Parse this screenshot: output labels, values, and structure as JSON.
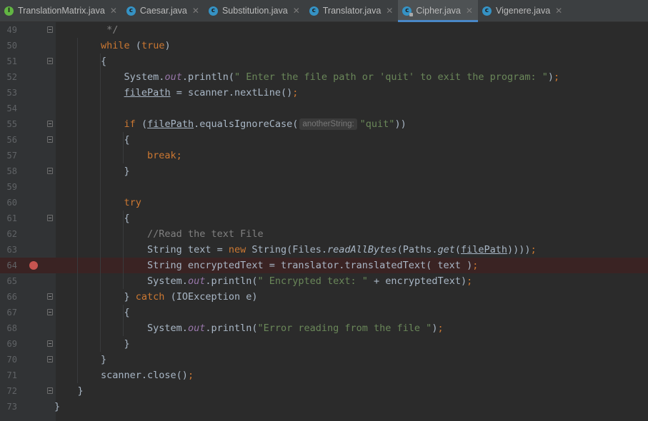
{
  "tabs": [
    {
      "label": "TranslationMatrix.java",
      "icon": "interface-icon"
    },
    {
      "label": "Caesar.java",
      "icon": "class-icon"
    },
    {
      "label": "Substitution.java",
      "icon": "class-icon"
    },
    {
      "label": "Translator.java",
      "icon": "class-icon"
    },
    {
      "label": "Cipher.java",
      "icon": "class-icon",
      "active": true
    },
    {
      "label": "Vigenere.java",
      "icon": "class-icon"
    }
  ],
  "close_glyph": "✕",
  "lines": [
    {
      "num": "49",
      "tokens": [
        {
          "t": "         */",
          "c": "cmt"
        }
      ]
    },
    {
      "num": "50",
      "tokens": [
        {
          "t": "        "
        },
        {
          "t": "while",
          "c": "kw"
        },
        {
          "t": " ("
        },
        {
          "t": "true",
          "c": "kw"
        },
        {
          "t": ")"
        }
      ]
    },
    {
      "num": "51",
      "tokens": [
        {
          "t": "        {"
        }
      ]
    },
    {
      "num": "52",
      "tokens": [
        {
          "t": "            System."
        },
        {
          "t": "out",
          "c": "fld"
        },
        {
          "t": ".println("
        },
        {
          "t": "\" Enter the file path or 'quit' to exit the program: \"",
          "c": "str"
        },
        {
          "t": ")"
        },
        {
          "t": ";",
          "c": "kw"
        }
      ]
    },
    {
      "num": "53",
      "tokens": [
        {
          "t": "            "
        },
        {
          "t": "filePath",
          "c": "ul"
        },
        {
          "t": " = scanner.nextLine()"
        },
        {
          "t": ";",
          "c": "kw"
        }
      ]
    },
    {
      "num": "54",
      "tokens": [
        {
          "t": ""
        }
      ]
    },
    {
      "num": "55",
      "tokens": [
        {
          "t": "            "
        },
        {
          "t": "if",
          "c": "kw"
        },
        {
          "t": " ("
        },
        {
          "t": "filePath",
          "c": "ul"
        },
        {
          "t": ".equalsIgnoreCase("
        },
        {
          "t": "anotherString:",
          "c": "hint"
        },
        {
          "t": "\"quit\"",
          "c": "str"
        },
        {
          "t": "))"
        }
      ]
    },
    {
      "num": "56",
      "tokens": [
        {
          "t": "            {"
        }
      ]
    },
    {
      "num": "57",
      "tokens": [
        {
          "t": "                "
        },
        {
          "t": "break;",
          "c": "kw"
        }
      ]
    },
    {
      "num": "58",
      "tokens": [
        {
          "t": "            }"
        }
      ]
    },
    {
      "num": "59",
      "tokens": [
        {
          "t": ""
        }
      ]
    },
    {
      "num": "60",
      "tokens": [
        {
          "t": "            "
        },
        {
          "t": "try",
          "c": "kw"
        }
      ]
    },
    {
      "num": "61",
      "tokens": [
        {
          "t": "            {"
        }
      ]
    },
    {
      "num": "62",
      "tokens": [
        {
          "t": "                "
        },
        {
          "t": "//Read the text File",
          "c": "cmt"
        }
      ]
    },
    {
      "num": "63",
      "tokens": [
        {
          "t": "                String text = "
        },
        {
          "t": "new",
          "c": "kw"
        },
        {
          "t": " String(Files."
        },
        {
          "t": "readAllBytes",
          "c": "stat"
        },
        {
          "t": "(Paths."
        },
        {
          "t": "get",
          "c": "stat"
        },
        {
          "t": "("
        },
        {
          "t": "filePath",
          "c": "ul"
        },
        {
          "t": "))))"
        },
        {
          "t": ";",
          "c": "kw"
        }
      ]
    },
    {
      "num": "64",
      "tokens": [
        {
          "t": "                String encryptedText = translator.translatedText( text )"
        },
        {
          "t": ";",
          "c": "kw"
        }
      ]
    },
    {
      "num": "65",
      "tokens": [
        {
          "t": "                System."
        },
        {
          "t": "out",
          "c": "fld"
        },
        {
          "t": ".println("
        },
        {
          "t": "\" Encrypted text: \"",
          "c": "str"
        },
        {
          "t": " + encryptedText)"
        },
        {
          "t": ";",
          "c": "kw"
        }
      ]
    },
    {
      "num": "66",
      "tokens": [
        {
          "t": "            } "
        },
        {
          "t": "catch",
          "c": "kw"
        },
        {
          "t": " (IOException e)"
        }
      ]
    },
    {
      "num": "67",
      "tokens": [
        {
          "t": "            {"
        }
      ]
    },
    {
      "num": "68",
      "tokens": [
        {
          "t": "                System."
        },
        {
          "t": "out",
          "c": "fld"
        },
        {
          "t": ".println("
        },
        {
          "t": "\"Error reading from the file \"",
          "c": "str"
        },
        {
          "t": ")"
        },
        {
          "t": ";",
          "c": "kw"
        }
      ]
    },
    {
      "num": "69",
      "tokens": [
        {
          "t": "            }"
        }
      ]
    },
    {
      "num": "70",
      "tokens": [
        {
          "t": "        }"
        }
      ]
    },
    {
      "num": "71",
      "tokens": [
        {
          "t": "        scanner.close()"
        },
        {
          "t": ";",
          "c": "kw"
        }
      ]
    },
    {
      "num": "72",
      "tokens": [
        {
          "t": "    }"
        }
      ]
    },
    {
      "num": "73",
      "tokens": [
        {
          "t": "}"
        }
      ]
    }
  ],
  "breakpoint_line": "64",
  "fold_lines": [
    "49",
    "51",
    "55",
    "56",
    "58",
    "61",
    "66",
    "67",
    "69",
    "70",
    "72"
  ],
  "colors": {
    "background": "#2b2b2b",
    "gutter": "#313335",
    "keyword": "#cc7832",
    "string": "#6a8759",
    "comment": "#808080",
    "field": "#9876aa",
    "breakpoint": "#c75450",
    "active_tab_underline": "#4a88c7"
  }
}
